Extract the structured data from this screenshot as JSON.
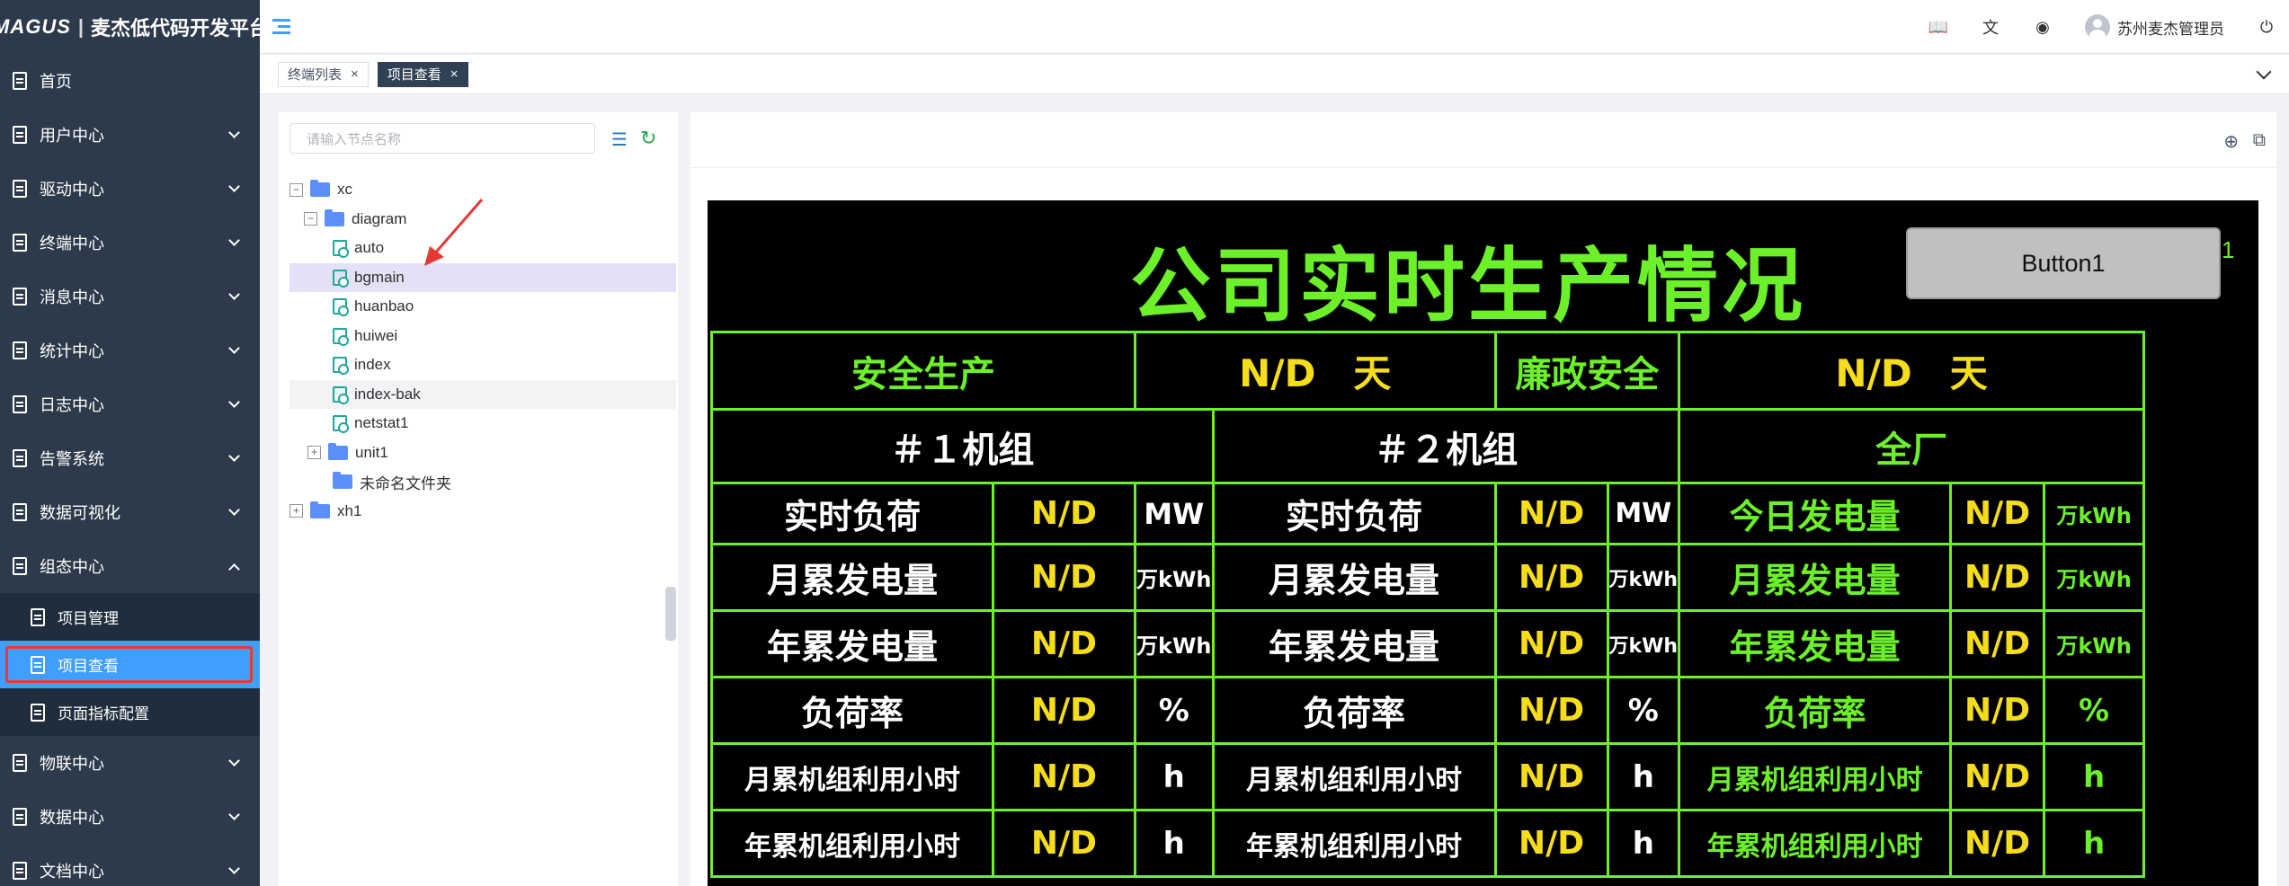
{
  "app": {
    "logo_mark": "MAGUS",
    "logo_sep": "|",
    "name": "麦杰低代码开发平台"
  },
  "sidebar": {
    "items": [
      {
        "label": "首页"
      },
      {
        "label": "用户中心"
      },
      {
        "label": "驱动中心"
      },
      {
        "label": "终端中心"
      },
      {
        "label": "消息中心"
      },
      {
        "label": "统计中心"
      },
      {
        "label": "日志中心"
      },
      {
        "label": "告警系统"
      },
      {
        "label": "数据可视化"
      },
      {
        "label": "组态中心"
      }
    ],
    "sub_items": [
      {
        "label": "项目管理"
      },
      {
        "label": "项目查看"
      },
      {
        "label": "页面指标配置"
      }
    ],
    "items_after": [
      {
        "label": "物联中心"
      },
      {
        "label": "数据中心"
      },
      {
        "label": "文档中心"
      }
    ]
  },
  "header": {
    "user_name": "苏州麦杰管理员"
  },
  "tags": [
    {
      "label": "终端列表",
      "close": "×"
    },
    {
      "label": "项目查看",
      "close": "×"
    }
  ],
  "tree": {
    "search_placeholder": "请输入节点名称",
    "nodes": [
      {
        "label": "xc",
        "toggle": "−"
      },
      {
        "label": "diagram",
        "toggle": "−"
      },
      {
        "label": "auto"
      },
      {
        "label": "bgmain"
      },
      {
        "label": "huanbao"
      },
      {
        "label": "huiwei"
      },
      {
        "label": "index"
      },
      {
        "label": "index-bak"
      },
      {
        "label": "netstat1"
      },
      {
        "label": "unit1",
        "toggle": "+"
      },
      {
        "label": "未命名文件夹"
      },
      {
        "label": "xh1",
        "toggle": "+"
      }
    ]
  },
  "screen": {
    "title": "公司实时生产情况",
    "button": "Button1",
    "side_text": "1",
    "row_safety": [
      "安全生产",
      "N/D　天",
      "廉政安全",
      "N/D　天"
    ],
    "units": [
      "＃１机组",
      "＃２机组",
      "全厂"
    ],
    "rows": [
      {
        "u1": [
          "实时负荷",
          "N/D",
          "MW"
        ],
        "u2": [
          "实时负荷",
          "N/D",
          "MW"
        ],
        "all": [
          "今日发电量",
          "N/D",
          "万kWh"
        ]
      },
      {
        "u1": [
          "月累发电量",
          "N/D",
          "万kWh"
        ],
        "u2": [
          "月累发电量",
          "N/D",
          "万kWh"
        ],
        "all": [
          "月累发电量",
          "N/D",
          "万kWh"
        ]
      },
      {
        "u1": [
          "年累发电量",
          "N/D",
          "万kWh"
        ],
        "u2": [
          "年累发电量",
          "N/D",
          "万kWh"
        ],
        "all": [
          "年累发电量",
          "N/D",
          "万kWh"
        ]
      },
      {
        "u1": [
          "负荷率",
          "N/D",
          "%"
        ],
        "u2": [
          "负荷率",
          "N/D",
          "%"
        ],
        "all": [
          "负荷率",
          "N/D",
          "%"
        ]
      },
      {
        "u1": [
          "月累机组利用小时",
          "N/D",
          "h"
        ],
        "u2": [
          "月累机组利用小时",
          "N/D",
          "h"
        ],
        "all": [
          "月累机组利用小时",
          "N/D",
          "h"
        ]
      },
      {
        "u1": [
          "年累机组利用小时",
          "N/D",
          "h"
        ],
        "u2": [
          "年累机组利用小时",
          "N/D",
          "h"
        ],
        "all": [
          "年累机组利用小时",
          "N/D",
          "h"
        ]
      }
    ]
  },
  "colors": {
    "sidebar_bg": "#2d3a4b",
    "accent": "#409eff",
    "screen_green": "#6cf02a",
    "screen_yellow": "#f5dd1c"
  }
}
